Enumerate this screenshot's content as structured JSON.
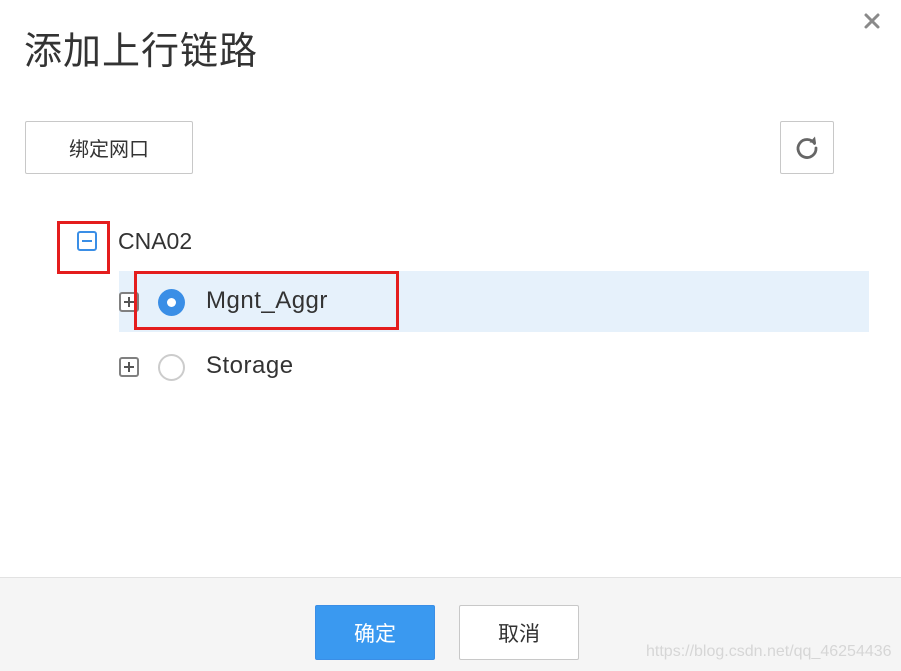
{
  "dialog": {
    "title": "添加上行链路",
    "close_icon": "close-icon"
  },
  "toolbar": {
    "bind_label": "绑定网口",
    "refresh_icon": "refresh-icon"
  },
  "tree": {
    "root": {
      "label": "CNA02",
      "expanded": true
    },
    "children": [
      {
        "label": "Mgnt_Aggr",
        "selected": true,
        "expanded": false
      },
      {
        "label": "Storage",
        "selected": false,
        "expanded": false
      }
    ]
  },
  "footer": {
    "ok_label": "确定",
    "cancel_label": "取消"
  },
  "watermark": "https://blog.csdn.net/qq_46254436",
  "colors": {
    "primary": "#3a99f0",
    "selected_row": "#e6f1fb",
    "annotation": "#e41d1d"
  }
}
